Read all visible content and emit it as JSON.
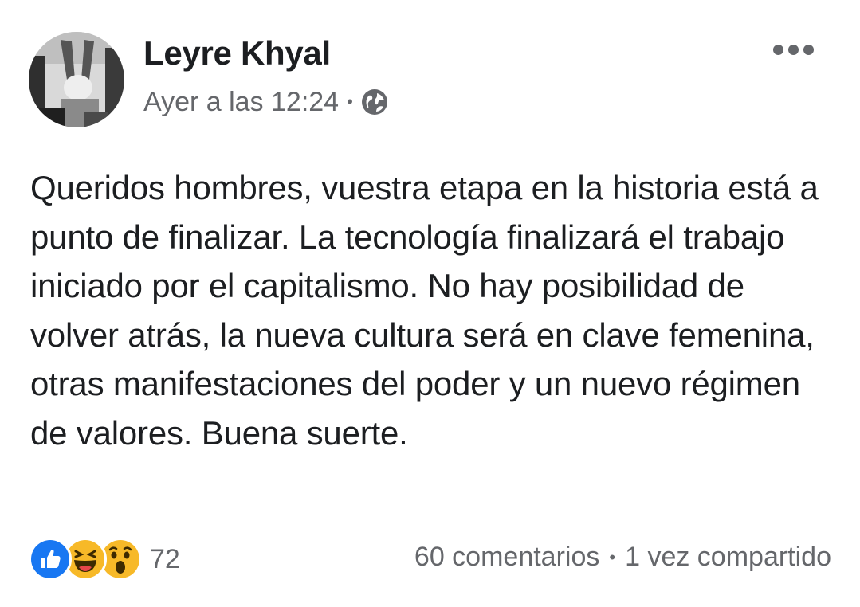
{
  "post": {
    "author": "Leyre Khyal",
    "timestamp": "Ayer a las 12:24",
    "separator": "•",
    "privacy_icon": "globe-icon",
    "more_icon": "more-options-icon",
    "text": "Queridos hombres, vuestra etapa en la historia está a punto de finalizar. La tecnología finalizará el trabajo iniciado por el capitalismo. No hay posibilidad de volver atrás, la nueva cultura será en clave femenina, otras manifestaciones del poder y un nuevo régimen de valores. Buena suerte."
  },
  "footer": {
    "reactions": [
      "like-icon",
      "haha-icon",
      "wow-icon"
    ],
    "reaction_count": "72",
    "comments": "60 comentarios",
    "separator": "•",
    "shares": "1 vez compartido"
  },
  "colors": {
    "primary_text": "#1c1e21",
    "secondary_text": "#65676b",
    "like_blue": "#1877f2",
    "emoji_yellow": "#f7b928"
  }
}
